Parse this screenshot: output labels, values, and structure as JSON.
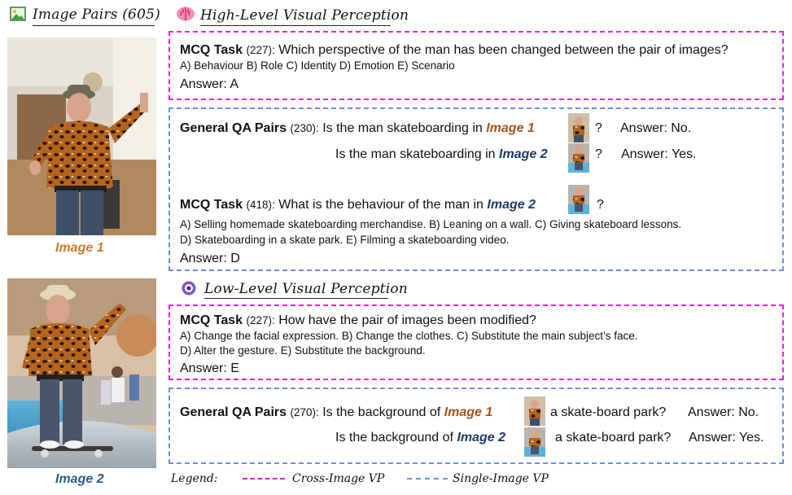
{
  "colors": {
    "cross": "#ee22dd",
    "single": "#6c92d8",
    "image1": "#a0561b",
    "image2": "#1f3a66"
  },
  "left": {
    "title": "Image Pairs (605)",
    "icon": "picture-icon",
    "image1_caption": "Image 1",
    "image2_caption": "Image 2"
  },
  "high": {
    "icon": "brain-icon",
    "title": "High-Level Visual Perception",
    "mcq": {
      "label": "MCQ Task",
      "count": "(227):",
      "question": "Which perspective of the man has been changed between the pair of images?",
      "options": "A) Behaviour B) Role C) Identity D) Emotion E) Scenario",
      "answer": "Answer: A"
    },
    "gqa": {
      "label": "General QA Pairs",
      "count": "(230):",
      "q1_prefix": "Is the man skateboarding in",
      "q1_image": "Image 1",
      "q1_mark": "?",
      "q1_answer": "Answer: No.",
      "q2_prefix": "Is the man skateboarding in",
      "q2_image": "Image 2",
      "q2_mark": "?",
      "q2_answer": "Answer: Yes."
    },
    "mcq2": {
      "label": "MCQ Task",
      "count": "(418):",
      "question": "What is the behaviour of the man in",
      "image": "Image 2",
      "mark": "?",
      "options1": "A) Selling homemade skateboarding merchandise. B) Leaning on a wall. C)  Giving skateboard lessons.",
      "options2": "D) Skateboarding in a skate park. E) Filming a skateboarding video.",
      "answer": "Answer: D"
    }
  },
  "low": {
    "icon": "eye-icon",
    "title": "Low-Level Visual Perception",
    "mcq": {
      "label": "MCQ Task",
      "count": "(227):",
      "question": "How have the pair of images been modified?",
      "options1": "A) Change the facial expression. B) Change the clothes. C) Substitute the main subject’s face.",
      "options2": "D) Alter the gesture. E) Substitute the background.",
      "answer": "Answer: E"
    },
    "gqa": {
      "label": "General QA Pairs",
      "count": "(270):",
      "q1_prefix": "Is the background of",
      "q1_image": "Image 1",
      "q1_suffix": "a skate-board park?",
      "q1_answer": "Answer: No.",
      "q2_prefix": "Is the background of",
      "q2_image": "Image 2",
      "q2_suffix": "a skate-board park?",
      "q2_answer": "Answer: Yes."
    }
  },
  "legend": {
    "label": "Legend:",
    "cross": "Cross-Image VP",
    "single": "Single-Image VP"
  }
}
